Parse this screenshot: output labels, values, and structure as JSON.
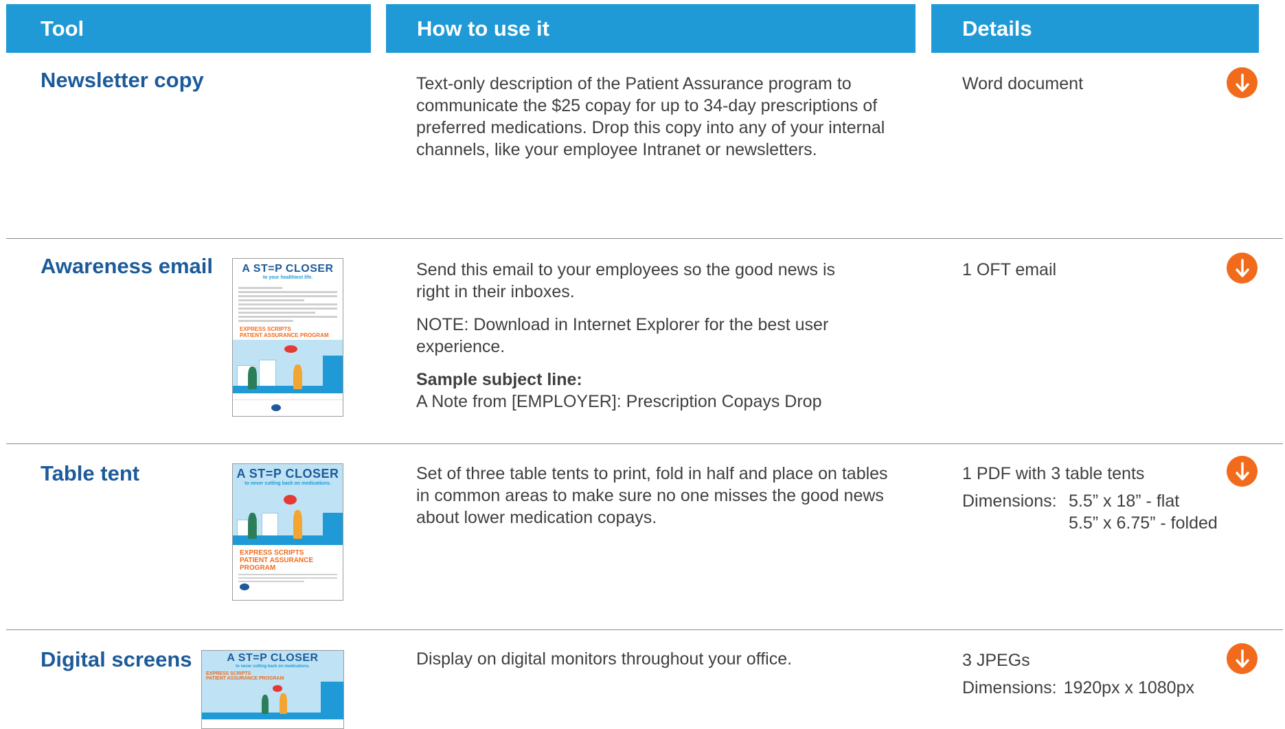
{
  "headers": {
    "tool": "Tool",
    "how": "How to use it",
    "details": "Details"
  },
  "rows": [
    {
      "name": "Newsletter copy",
      "description": [
        "Text-only description of the Patient Assurance program to communicate the $25 copay for up to 34-day prescriptions of preferred medications. Drop this copy into any of your internal channels, like your employee Intranet or newsletters."
      ],
      "details": [
        "Word document"
      ]
    },
    {
      "name": "Awareness email",
      "description": [
        "Send this email to your employees so the good news is right in their inboxes.",
        "NOTE: Download in Internet Explorer for the best user experience."
      ],
      "subject_label": "Sample subject line:",
      "subject_value": "A Note from [EMPLOYER]: Prescription Copays Drop",
      "details": [
        "1 OFT email"
      ],
      "thumb": {
        "title": "A ST=P CLOSER",
        "subtitle": "to your healthiest life.",
        "program_1": "EXPRESS SCRIPTS",
        "program_2": "PATIENT ASSURANCE PROGRAM"
      }
    },
    {
      "name": "Table tent",
      "description": [
        "Set of three table tents to print, fold in half and place on tables in common areas to make sure no one misses the good news about lower medication copays."
      ],
      "details": [
        "1 PDF with 3 table tents"
      ],
      "dimensions_label": "Dimensions:",
      "dimensions": [
        "5.5” x 18” - flat",
        "5.5” x 6.75” - folded"
      ],
      "thumb": {
        "title": "A ST=P CLOSER",
        "subtitle": "to never cutting back on medications.",
        "program_1": "EXPRESS SCRIPTS",
        "program_2": "PATIENT ASSURANCE PROGRAM"
      }
    },
    {
      "name": "Digital screens",
      "description": [
        "Display on digital monitors throughout your office."
      ],
      "details": [
        "3 JPEGs"
      ],
      "dimensions_label": "Dimensions:",
      "dimensions": [
        "1920px x 1080px"
      ],
      "thumb": {
        "title": "A ST=P CLOSER",
        "subtitle": "to never cutting back on medications.",
        "program_1": "EXPRESS SCRIPTS",
        "program_2": "PATIENT ASSURANCE PROGRAM"
      }
    }
  ],
  "icons": {
    "download": "download-arrow-icon"
  },
  "colors": {
    "header_bg": "#1f9ad6",
    "tool_name": "#1c5a9a",
    "download_button": "#f26b1d",
    "body_text": "#3f3f3f"
  }
}
